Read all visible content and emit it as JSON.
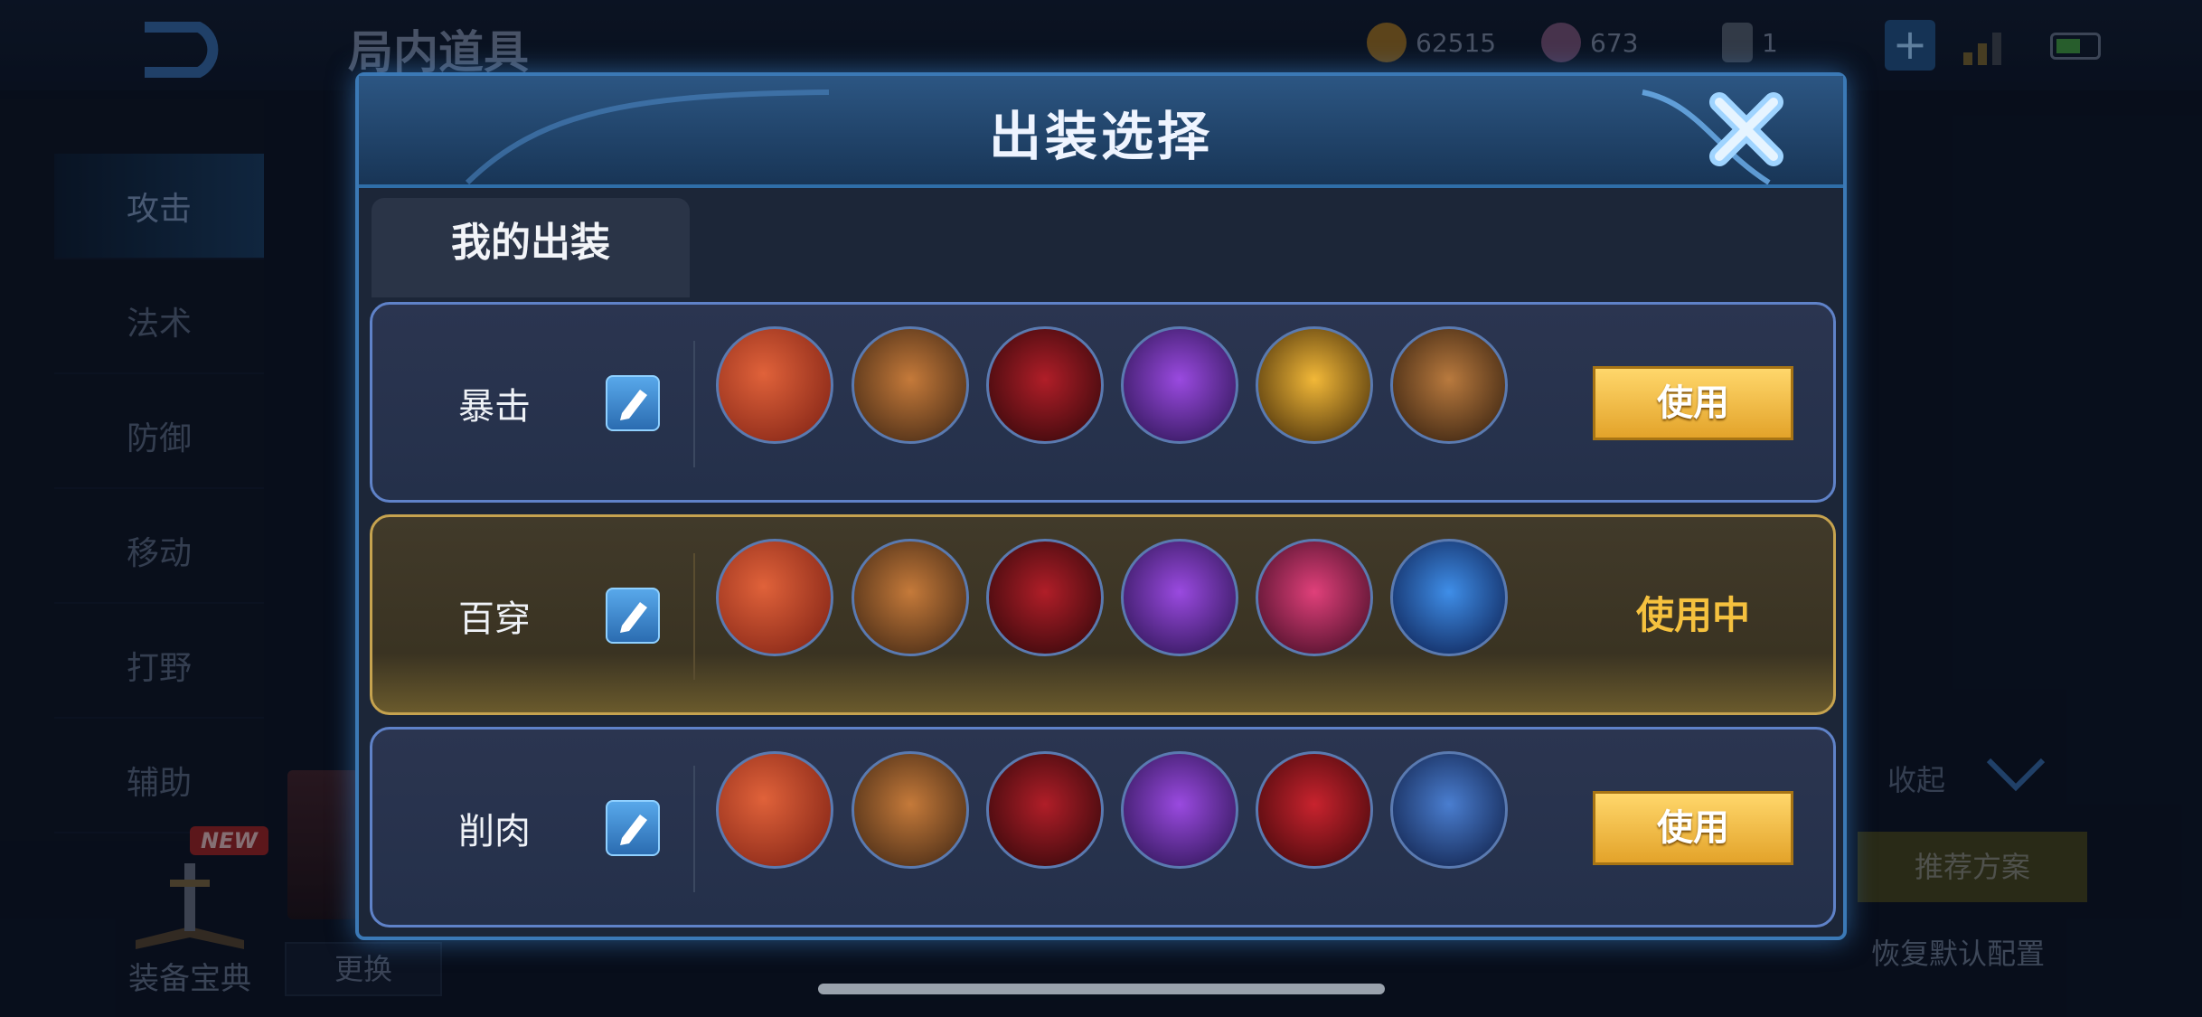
{
  "background": {
    "title": "局内道具",
    "resources": [
      {
        "icon": "gold-coin-icon",
        "value": "62515"
      },
      {
        "icon": "gem-icon",
        "value": "673"
      },
      {
        "icon": "card-icon",
        "value": "1"
      }
    ],
    "plus": "+",
    "sidebar": [
      "攻击",
      "法术",
      "防御",
      "移动",
      "打野",
      "辅助"
    ],
    "guide_label": "装备宝典",
    "new_badge": "NEW",
    "swap_label": "更换",
    "collapse_label": "收起",
    "recommend_label": "推荐方案",
    "reset_label": "恢复默认配置"
  },
  "dialog": {
    "title": "出装选择",
    "tab_label": "我的出装",
    "builds": [
      {
        "name": "暴击",
        "in_use": false,
        "action_label": "使用",
        "items": [
          "red-blade-item",
          "bronze-boots-item",
          "crimson-scythe-item",
          "purple-axe-item",
          "golden-wing-blade-item",
          "bronze-claw-item"
        ]
      },
      {
        "name": "百穿",
        "in_use": true,
        "action_label": "使用中",
        "items": [
          "red-blade-item",
          "bronze-boots-item",
          "crimson-scythe-item",
          "purple-axe-item",
          "magenta-blade-item",
          "blue-spear-item"
        ]
      },
      {
        "name": "削肉",
        "in_use": false,
        "action_label": "使用",
        "items": [
          "red-blade-item",
          "bronze-boots-item",
          "crimson-scythe-item",
          "purple-axe-item",
          "red-helmet-item",
          "blue-trident-item"
        ]
      }
    ]
  },
  "colors": {
    "gold_accent": "#f5c13e",
    "dialog_border": "#3b79b6",
    "use_button": "#e3a32a"
  }
}
